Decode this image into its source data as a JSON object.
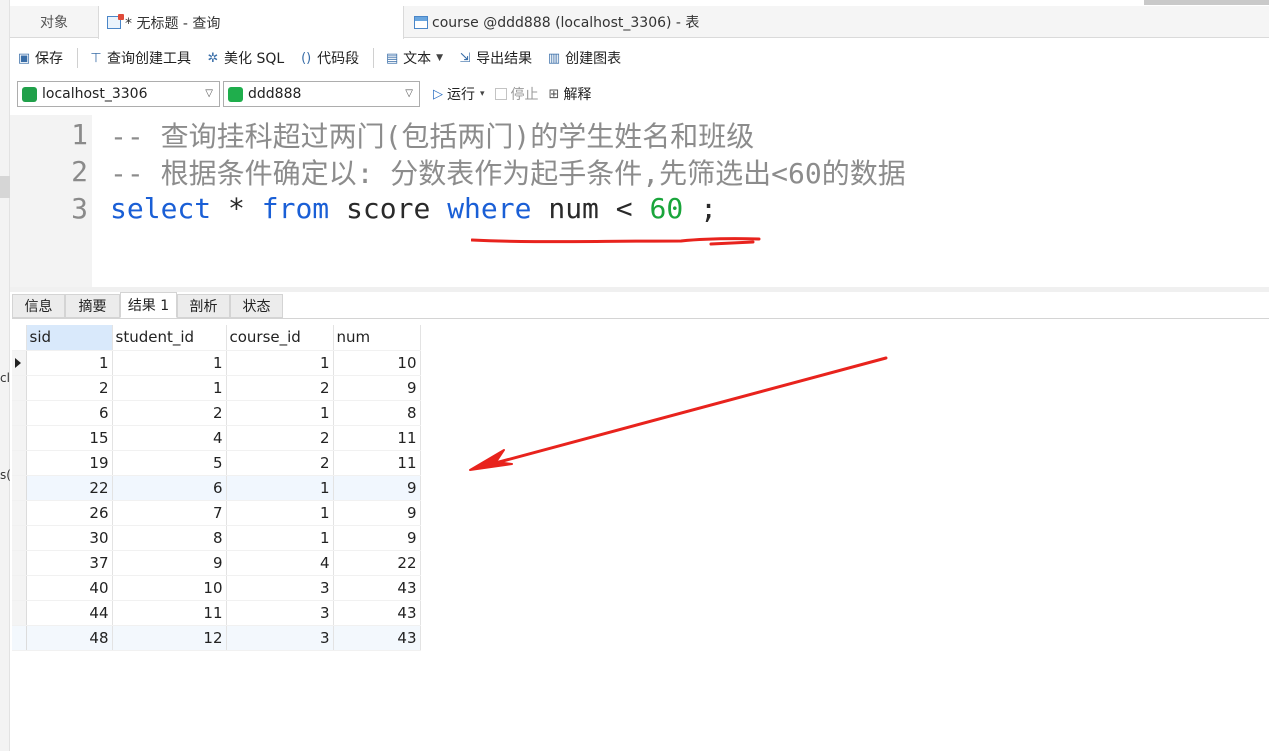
{
  "left_edge": {
    "fragment_1": "cl",
    "fragment_2": "s("
  },
  "tabs": [
    {
      "label": "对象"
    },
    {
      "label": "* 无标题 - 查询"
    },
    {
      "label": "course @ddd888 (localhost_3306) - 表"
    }
  ],
  "toolbar": {
    "save": "保存",
    "query_builder": "查询创建工具",
    "beautify_sql": "美化 SQL",
    "code_snippet": "代码段",
    "text": "文本",
    "export_results": "导出结果",
    "create_chart": "创建图表"
  },
  "connection": {
    "server": "localhost_3306",
    "database": "ddd888",
    "run": "运行",
    "stop": "停止",
    "explain": "解释"
  },
  "editor": {
    "lines": [
      {
        "number": "1",
        "text": "-- 查询挂科超过两门(包括两门)的学生姓名和班级"
      },
      {
        "number": "2",
        "text": "-- 根据条件确定以: 分数表作为起手条件,先筛选出<60的数据"
      },
      {
        "number": "3",
        "select": "select",
        "star": "*",
        "from": "from",
        "table": "score",
        "where": "where",
        "column": "num",
        "op": "<",
        "value": "60",
        "end": ";"
      }
    ]
  },
  "result_tabs": [
    "信息",
    "摘要",
    "结果 1",
    "剖析",
    "状态"
  ],
  "results": {
    "columns": [
      "sid",
      "student_id",
      "course_id",
      "num"
    ],
    "rows": [
      [
        "1",
        "1",
        "1",
        "10"
      ],
      [
        "2",
        "1",
        "2",
        "9"
      ],
      [
        "6",
        "2",
        "1",
        "8"
      ],
      [
        "15",
        "4",
        "2",
        "11"
      ],
      [
        "19",
        "5",
        "2",
        "11"
      ],
      [
        "22",
        "6",
        "1",
        "9"
      ],
      [
        "26",
        "7",
        "1",
        "9"
      ],
      [
        "30",
        "8",
        "1",
        "9"
      ],
      [
        "37",
        "9",
        "4",
        "22"
      ],
      [
        "40",
        "10",
        "3",
        "43"
      ],
      [
        "44",
        "11",
        "3",
        "43"
      ],
      [
        "48",
        "12",
        "3",
        "43"
      ]
    ]
  },
  "colors": {
    "keyword": "#1a5fd6",
    "number": "#1aa53b",
    "comment": "#8c8c8c",
    "annotation": "#e8231d"
  }
}
